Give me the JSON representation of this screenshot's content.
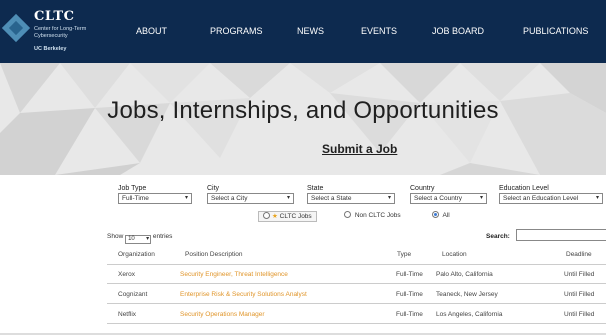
{
  "header": {
    "logo_title": "CLTC",
    "logo_subtitle": "Center for Long-Term Cybersecurity",
    "logo_ucb": "UC Berkeley",
    "nav": [
      "ABOUT",
      "PROGRAMS",
      "NEWS",
      "EVENTS",
      "JOB BOARD",
      "PUBLICATIONS"
    ]
  },
  "hero": {
    "title": "Jobs, Internships, and Opportunities",
    "submit_link": "Submit a Job"
  },
  "filters": {
    "job_type": {
      "label": "Job Type",
      "value": "Full-Time"
    },
    "city": {
      "label": "City",
      "value": "Select a City"
    },
    "state": {
      "label": "State",
      "value": "Select a State"
    },
    "country": {
      "label": "Country",
      "value": "Select a Country"
    },
    "education": {
      "label": "Education Level",
      "value": "Select an Education Level"
    },
    "radios": {
      "cltc": "CLTC Jobs",
      "non_cltc": "Non CLTC Jobs",
      "all": "All",
      "selected": "All"
    }
  },
  "table_controls": {
    "show": "Show",
    "entries_value": "10",
    "entries": "entries",
    "search_label": "Search:",
    "search_value": ""
  },
  "table": {
    "columns": [
      "Organization",
      "Position Description",
      "Type",
      "Location",
      "Deadline"
    ],
    "rows": [
      [
        "Xerox",
        "Security Engineer, Threat Intelligence",
        "Full-Time",
        "Palo Alto, California",
        "Until Filled"
      ],
      [
        "Cognizant",
        "Enterprise Risk & Security Solutions Analyst",
        "Full-Time",
        "Teaneck, New Jersey",
        "Until Filled"
      ],
      [
        "Netflix",
        "Security Operations Manager",
        "Full-Time",
        "Los Angeles, California",
        "Until Filled"
      ]
    ]
  },
  "colors": {
    "header_bg": "#0d2a4f",
    "link_orange": "#e0952a",
    "star": "#e8a31c"
  }
}
